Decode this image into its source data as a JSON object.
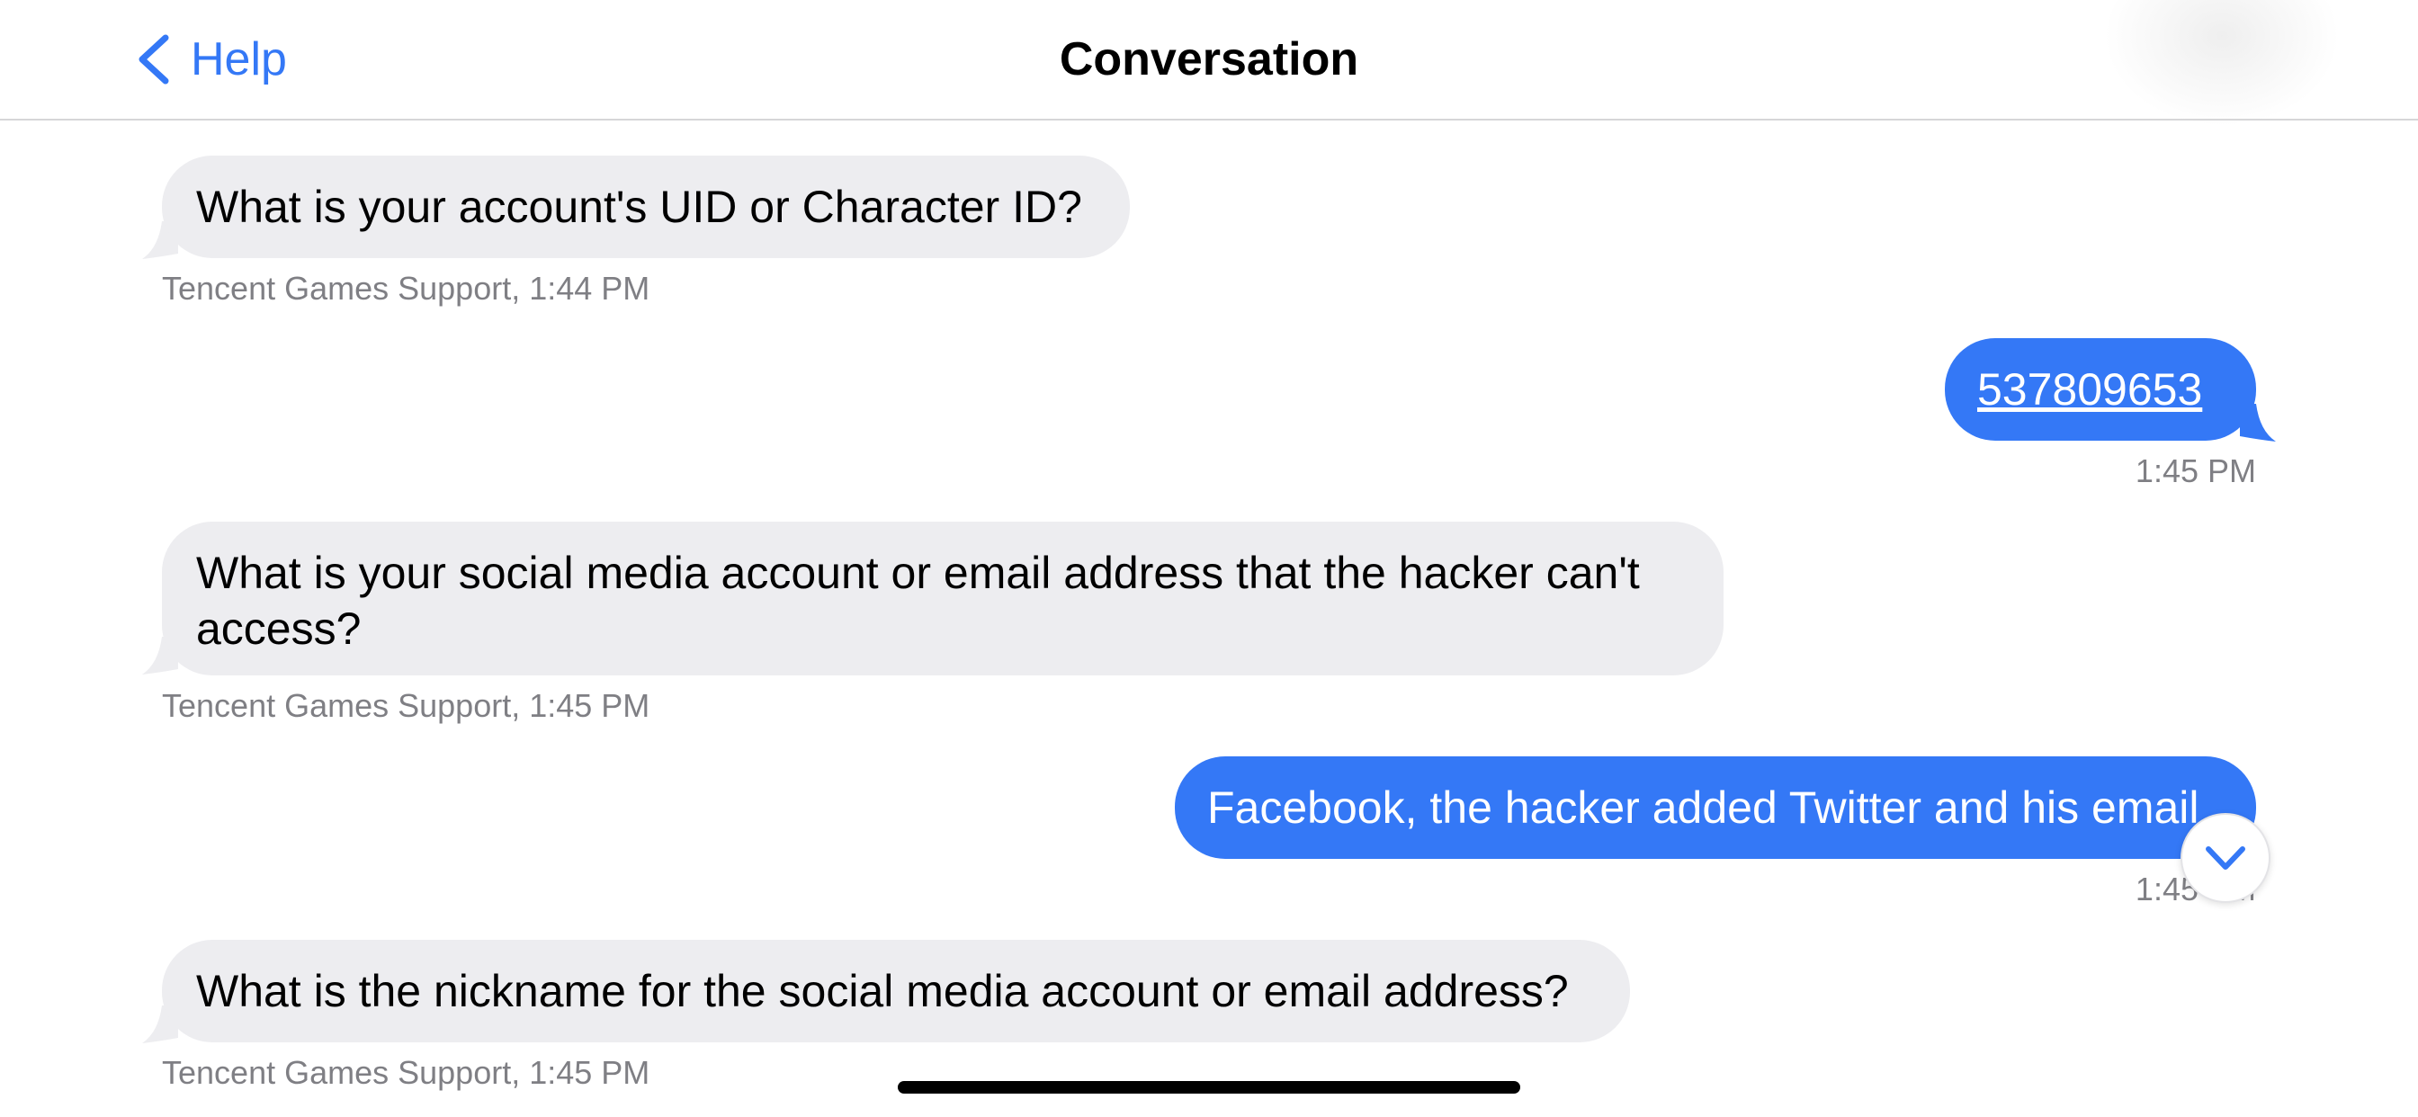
{
  "header": {
    "back_label": "Help",
    "title": "Conversation"
  },
  "messages": [
    {
      "direction": "incoming",
      "text": "What is your account's UID or Character ID?",
      "meta": "Tencent Games Support, 1:44 PM"
    },
    {
      "direction": "outgoing",
      "text": "537809653",
      "meta": "1:45 PM"
    },
    {
      "direction": "incoming",
      "text": "What is your social media account or email address that the hacker can't access?",
      "meta": "Tencent Games Support, 1:45 PM"
    },
    {
      "direction": "outgoing",
      "text": "Facebook, the hacker added Twitter and his email",
      "meta": "1:45 PM"
    },
    {
      "direction": "incoming",
      "text": "What is the nickname for the social media account or email address?",
      "meta": "Tencent Games Support, 1:45 PM"
    }
  ],
  "icons": {
    "back": "chevron-left-icon",
    "scroll_down": "chevron-down-icon"
  },
  "colors": {
    "accent": "#3478f6",
    "incoming_bubble": "#ededf0",
    "meta_text": "#7f7f84"
  }
}
